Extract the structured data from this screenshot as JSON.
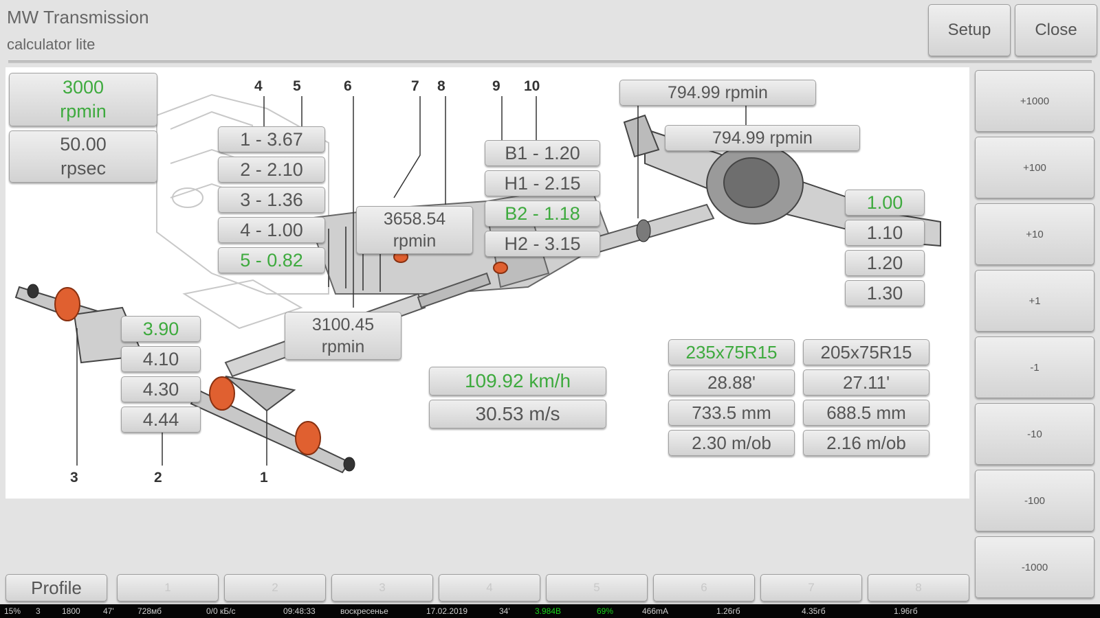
{
  "header": {
    "title": "MW Transmission",
    "subtitle": "calculator lite",
    "setup_label": "Setup",
    "close_label": "Close"
  },
  "engine": {
    "rpm_value": "3000",
    "rpm_unit": "rpmin",
    "rps_value": "50.00",
    "rps_unit": "rpsec"
  },
  "diagram_numbers": [
    "4",
    "5",
    "6",
    "7",
    "8",
    "9",
    "10",
    "3",
    "2",
    "1"
  ],
  "gears": [
    "1 - 3.67",
    "2 - 2.10",
    "3 - 1.36",
    "4 - 1.00",
    "5 - 0.82"
  ],
  "selected_gear": "5 - 0.82",
  "transfer": [
    "B1 - 1.20",
    "H1 - 2.15",
    "B2 - 1.18",
    "H2 - 3.15"
  ],
  "selected_transfer": "B2 - 1.18",
  "mid_rpm": {
    "value": "3658.54",
    "unit": "rpmin"
  },
  "shaft_rpm": {
    "value": "3100.45",
    "unit": "rpmin"
  },
  "rear_rpm_1": "794.99 rpmin",
  "rear_rpm_2": "794.99 rpmin",
  "extra_ratios": [
    "1.00",
    "1.10",
    "1.20",
    "1.30"
  ],
  "selected_extra_ratio": "1.00",
  "final_drive": [
    "3.90",
    "4.10",
    "4.30",
    "4.44"
  ],
  "selected_final_drive": "3.90",
  "speed": {
    "kmh": "109.92 km/h",
    "ms": "30.53 m/s"
  },
  "tires": {
    "left": [
      "235x75R15",
      "28.88'",
      "733.5 mm",
      "2.30 m/ob"
    ],
    "right": [
      "205x75R15",
      "27.11'",
      "688.5 mm",
      "2.16 m/ob"
    ],
    "selected": "235x75R15"
  },
  "increment_buttons": [
    "+1000",
    "+100",
    "+10",
    "+1",
    "-1",
    "-10",
    "-100",
    "-1000"
  ],
  "bottom": {
    "profile_label": "Profile",
    "slots": [
      "1",
      "2",
      "3",
      "4",
      "5",
      "6",
      "7",
      "8"
    ]
  },
  "status_bar": [
    "15%",
    "3",
    "1800",
    "47'",
    "728мб",
    "0/0 кБ/с",
    "09:48:33",
    "воскресенье",
    "17.02.2019",
    "34'",
    "3.984В",
    "69%",
    "466mA",
    "1.26гб",
    "4.35гб",
    "1.96гб"
  ],
  "colors": {
    "selected_text": "#3eaa3e",
    "panel_bg": "#e3e3e3",
    "drawing_bg": "#ffffff"
  }
}
